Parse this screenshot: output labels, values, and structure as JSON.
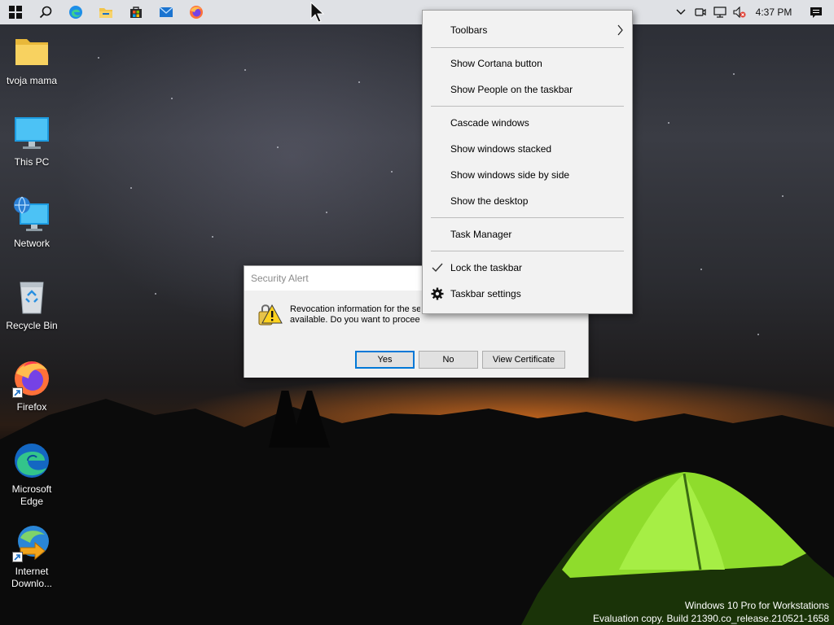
{
  "taskbar": {
    "pinned": [
      {
        "name": "start",
        "icon": "windows-logo-icon"
      },
      {
        "name": "search",
        "icon": "search-icon"
      },
      {
        "name": "edge",
        "icon": "edge-icon"
      },
      {
        "name": "file-explorer",
        "icon": "folder-icon"
      },
      {
        "name": "store",
        "icon": "store-icon"
      },
      {
        "name": "mail",
        "icon": "mail-icon"
      },
      {
        "name": "firefox",
        "icon": "firefox-icon"
      }
    ],
    "tray": {
      "icons": [
        "chevron-up-icon",
        "meet-now-icon",
        "network-icon",
        "volume-muted-icon"
      ],
      "clock": "4:37 PM",
      "notification_icon": "action-center-icon"
    }
  },
  "desktop": {
    "icons": [
      {
        "label": "tvoja mama",
        "icon": "folder-icon"
      },
      {
        "label": "This PC",
        "icon": "monitor-icon"
      },
      {
        "label": "Network",
        "icon": "network-globe-icon"
      },
      {
        "label": "Recycle Bin",
        "icon": "recycle-bin-icon"
      },
      {
        "label": "Firefox",
        "icon": "firefox-icon",
        "shortcut": true
      },
      {
        "label_line1": "Microsoft",
        "label_line2": "Edge",
        "icon": "edge-icon"
      },
      {
        "label_line1": "Internet",
        "label_line2": "Downlo...",
        "icon": "idm-icon",
        "shortcut": true
      }
    ]
  },
  "dialog": {
    "title": "Security Alert",
    "message_line1": "Revocation information for the sec",
    "message_line2": "available. Do you want to proceed?",
    "icon": "warning-lock-icon",
    "buttons": {
      "yes": "Yes",
      "no": "No",
      "view": "View Certificate"
    }
  },
  "context_menu": {
    "items": [
      {
        "label": "Toolbars",
        "submenu": true
      },
      {
        "label": "Show Cortana button"
      },
      {
        "label": "Show People on the taskbar"
      },
      {
        "label": "Cascade windows"
      },
      {
        "label": "Show windows stacked"
      },
      {
        "label": "Show windows side by side"
      },
      {
        "label": "Show the desktop"
      },
      {
        "label": "Task Manager"
      },
      {
        "label": "Lock the taskbar",
        "checked": true
      },
      {
        "label": "Taskbar settings",
        "icon": "gear-icon"
      }
    ]
  },
  "watermark": {
    "line1": "Windows 10 Pro for Workstations",
    "line2": "Evaluation copy. Build 21390.co_release.210521-1658"
  },
  "colors": {
    "accent": "#0078d7",
    "taskbar": "#dfe1e5",
    "menu_bg": "#f2f2f2",
    "dialog_bg": "#f0f0f0",
    "tent_green": "#9be33a"
  }
}
